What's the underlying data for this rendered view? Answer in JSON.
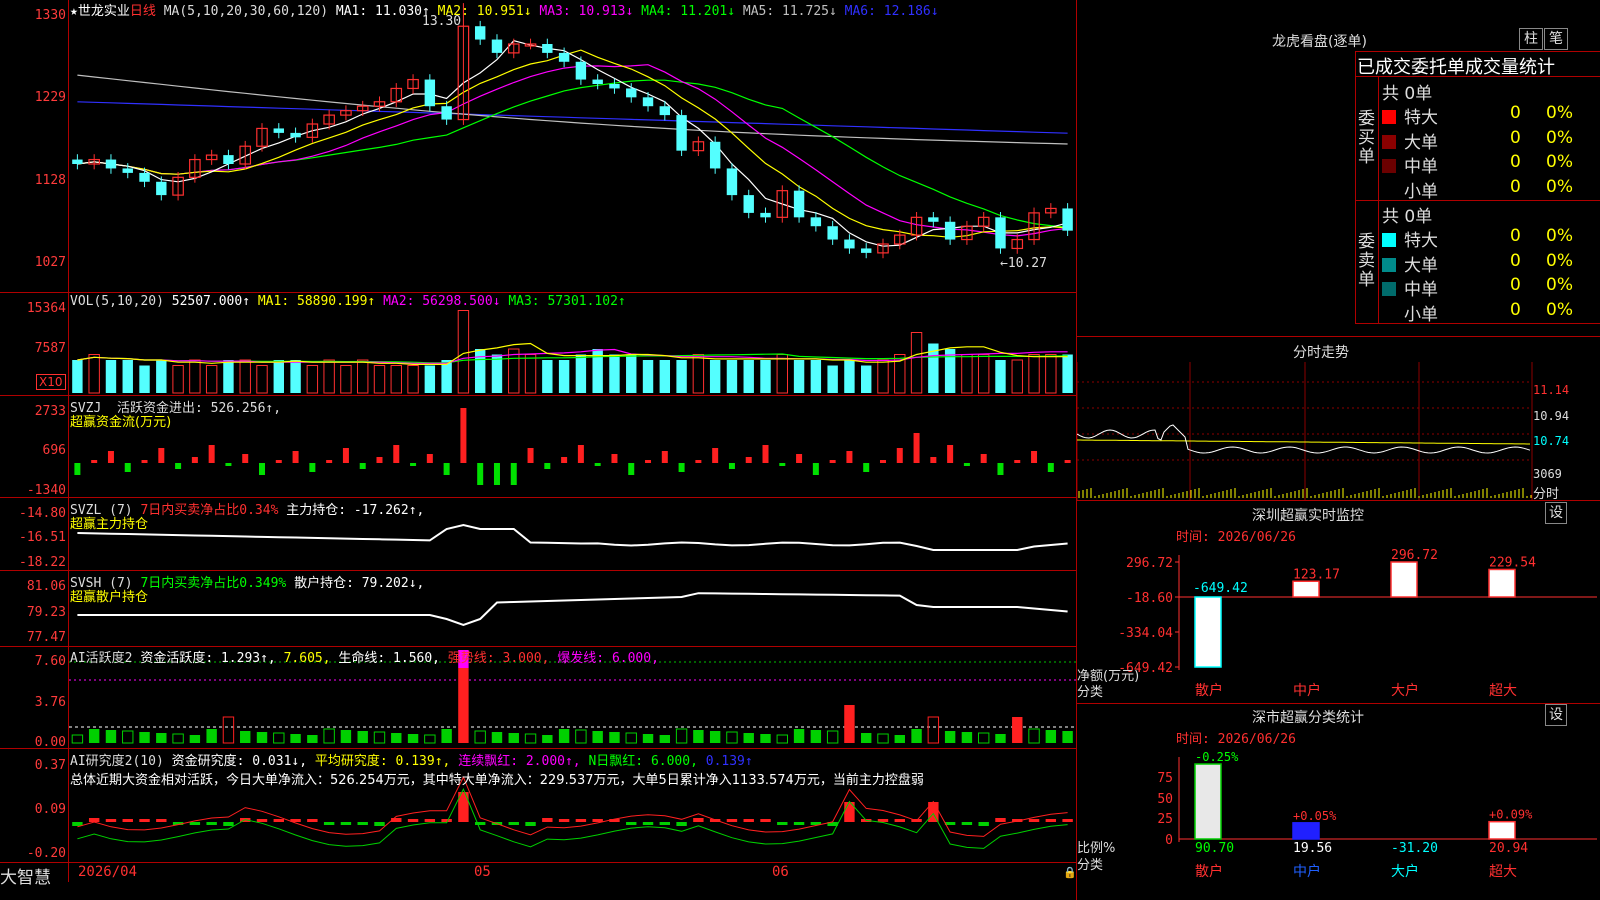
{
  "stock": {
    "star": "★",
    "name": "世龙实业",
    "period": "日线"
  },
  "panel_main": {
    "ma_label": "MA(5,10,20,30,60,120)",
    "ma_values": [
      {
        "text": "MA1: 11.030↑",
        "color": "#ffffff"
      },
      {
        "text": "MA2: 10.951↓",
        "color": "#ffff00"
      },
      {
        "text": "MA3: 10.913↓",
        "color": "#ff00ff"
      },
      {
        "text": "MA4: 11.201↓",
        "color": "#00ff00"
      },
      {
        "text": "MA5: 11.725↓",
        "color": "#c0c0c0"
      },
      {
        "text": "MA6: 12.186↓",
        "color": "#3030ff"
      }
    ],
    "y_ticks": [
      "1330",
      "1229",
      "1128",
      "1027"
    ],
    "high_label": "13.30",
    "low_label": "←10.27"
  },
  "panel_vol": {
    "title": "VOL(5,10,20)",
    "value": "52507.000↑",
    "ma": [
      {
        "text": "MA1: 58890.199↑",
        "color": "#ffff00"
      },
      {
        "text": "MA2: 56298.500↓",
        "color": "#ff00ff"
      },
      {
        "text": "MA3: 57301.102↑",
        "color": "#00ff00"
      }
    ],
    "y_ticks": [
      "15364",
      "7587"
    ],
    "unit": "X10"
  },
  "panel_svzj": {
    "title": "SVZJ",
    "text1": "活跃资金进出: 526.256↑,",
    "text2": "超赢资金流(万元)",
    "y_ticks": [
      "2733",
      "696",
      "-1340"
    ]
  },
  "panel_svzl": {
    "title": "SVZL (7)",
    "text1": "7日内买卖净占比0.34%",
    "text2": "主力持仓: -17.262↑,",
    "text3": "超赢主力持仓",
    "y_ticks": [
      "-14.80",
      "-16.51",
      "-18.22"
    ]
  },
  "panel_svsh": {
    "title": "SVSH (7)",
    "text1": "7日内买卖净占比0.349%",
    "text2": "散户持仓: 79.202↓,",
    "text3": "超赢散户持仓",
    "y_ticks": [
      "81.06",
      "79.23",
      "77.47"
    ]
  },
  "panel_ai1": {
    "title": "AI活跃度2",
    "t1": "资金活跃度: 1.293↑,",
    "t2": "7.605,",
    "t3": "生命线: 1.560,",
    "t4": "强势线: 3.000,",
    "t5": "爆发线: 6.000,",
    "y_ticks": [
      "7.60",
      "3.76",
      "0.00"
    ]
  },
  "panel_ai2": {
    "title": "AI研究度2(10)",
    "t1": "资金研究度: 0.031↓,",
    "t2": "平均研究度: 0.139↑,",
    "t3": "连续飘红: 2.000↑,",
    "t4": "N日飘红: 6.000,",
    "t5": "0.139↑",
    "summary": "总体近期大资金相对活跃，今日大单净流入：526.254万元，其中特大单净流入：229.537万元，大单5日累计净入1133.574万元，当前主力控盘弱",
    "y_ticks": [
      "0.37",
      "0.09",
      "-0.20"
    ]
  },
  "date_axis": {
    "labels": [
      "2026/04",
      "05",
      "06"
    ]
  },
  "brand": "大智慧",
  "lhb": {
    "title": "龙虎看盘(逐单)",
    "btn1": "柱",
    "btn2": "笔",
    "tabs": "已成交委托单成交量统计",
    "buy_label": "委买单",
    "sell_label": "委卖单",
    "buy_total": "共 0单",
    "sell_total": "共 0单",
    "buy_rows": [
      {
        "name": "特大",
        "color": "#ff0000",
        "n": "0",
        "p": "0%"
      },
      {
        "name": "大单",
        "color": "#8b0000",
        "n": "0",
        "p": "0%"
      },
      {
        "name": "中单",
        "color": "#6b0000",
        "n": "0",
        "p": "0%"
      },
      {
        "name": "小单",
        "color": "#000000",
        "n": "0",
        "p": "0%"
      }
    ],
    "sell_rows": [
      {
        "name": "特大",
        "color": "#00ffff",
        "n": "0",
        "p": "0%"
      },
      {
        "name": "大单",
        "color": "#008b8b",
        "n": "0",
        "p": "0%"
      },
      {
        "name": "中单",
        "color": "#006b6b",
        "n": "0",
        "p": "0%"
      },
      {
        "name": "小单",
        "color": "#000000",
        "n": "0",
        "p": "0%"
      }
    ]
  },
  "intraday": {
    "title": "分时走势",
    "y_ticks": [
      "11.14",
      "10.94",
      "10.74"
    ],
    "vol_tick": "3069",
    "label": "分时"
  },
  "sz_monitor": {
    "title": "深圳超赢实时监控",
    "btn": "设",
    "time": "时间: 2026/06/26",
    "y_ticks": [
      "296.72",
      "-18.60",
      "-334.04",
      "-649.42"
    ],
    "y_label1": "净额(万元)",
    "y_label2": "分类",
    "categories": [
      "散户",
      "中户",
      "大户",
      "超大"
    ],
    "values": [
      -649.42,
      123.17,
      296.72,
      229.54
    ],
    "value_labels": [
      "-649.42",
      "123.17",
      "296.72",
      "229.54"
    ]
  },
  "sz_class": {
    "title": "深市超赢分类统计",
    "btn": "设",
    "time": "时间: 2026/06/26",
    "y_ticks": [
      "75",
      "50",
      "25",
      "0"
    ],
    "y_label1": "比例%",
    "y_label2": "分类",
    "categories": [
      "散户",
      "中户",
      "大户",
      "超大"
    ],
    "change_labels": [
      "-0.25%",
      "+0.05%",
      "",
      "+0.09%"
    ],
    "values": [
      90.7,
      19.56,
      -31.2,
      20.94
    ],
    "value_labels": [
      "90.70",
      "19.56",
      "-31.20",
      "20.94"
    ]
  },
  "chart_data": [
    {
      "type": "candlestick",
      "title": "世龙实业 日线",
      "x": [
        "2026/04",
        "05",
        "06"
      ],
      "ylim": [
        10.27,
        13.3
      ],
      "high": 13.3,
      "low": 10.27,
      "close_series": [
        11.55,
        11.6,
        11.5,
        11.45,
        11.35,
        11.2,
        11.4,
        11.6,
        11.65,
        11.55,
        11.75,
        11.95,
        11.9,
        11.85,
        12.0,
        12.1,
        12.15,
        12.2,
        12.25,
        12.4,
        12.5,
        12.2,
        12.05,
        13.1,
        12.95,
        12.8,
        12.9,
        12.9,
        12.8,
        12.7,
        12.5,
        12.45,
        12.4,
        12.3,
        12.2,
        12.1,
        11.7,
        11.8,
        11.5,
        11.2,
        11.0,
        10.95,
        11.25,
        10.95,
        10.85,
        10.7,
        10.6,
        10.55,
        10.65,
        10.75,
        10.95,
        10.9,
        10.7,
        10.85,
        10.95,
        10.6,
        10.7,
        11.0,
        11.05,
        10.8
      ]
    },
    {
      "type": "bar",
      "name": "sz_monitor",
      "categories": [
        "散户",
        "中户",
        "大户",
        "超大"
      ],
      "values": [
        -649.42,
        123.17,
        296.72,
        229.54
      ],
      "ylim": [
        -649.42,
        296.72
      ]
    },
    {
      "type": "bar",
      "name": "sz_class",
      "categories": [
        "散户",
        "中户",
        "大户",
        "超大"
      ],
      "values": [
        90.7,
        19.56,
        -31.2,
        20.94
      ],
      "ylim": [
        0,
        75
      ]
    }
  ]
}
